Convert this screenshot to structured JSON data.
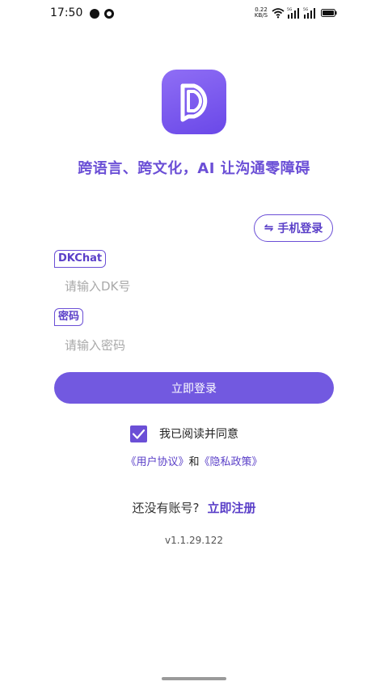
{
  "status_bar": {
    "time": "17:50",
    "net_speed_value": "0.22",
    "net_speed_unit": "KB/S",
    "signal_1_label": "5G",
    "signal_2_label": "5G",
    "icons": [
      "notification-dot-icon",
      "app-notification-icon",
      "wifi-icon",
      "signal-icon",
      "signal-icon",
      "battery-icon"
    ]
  },
  "brand": {
    "logo_icon": "dkchat-logo-icon",
    "slogan": "跨语言、跨文化，AI 让沟通零障碍",
    "accent_color": "#6b4fd6",
    "button_color": "#7259e0"
  },
  "switch_login": {
    "icon": "swap-icon",
    "label": "手机登录"
  },
  "form": {
    "dk_label": "DKChat",
    "dk_placeholder": "请输入DK号",
    "dk_value": "",
    "password_label": "密码",
    "password_placeholder": "请输入密码",
    "password_value": "",
    "login_button": "立即登录"
  },
  "agreement": {
    "checked": true,
    "text": "我已阅读并同意",
    "user_agreement": "《用户协议》",
    "and_text": "和",
    "privacy_policy": "《隐私政策》"
  },
  "register": {
    "prompt": "还没有账号?",
    "link": "立即注册"
  },
  "version": "v1.1.29.122"
}
